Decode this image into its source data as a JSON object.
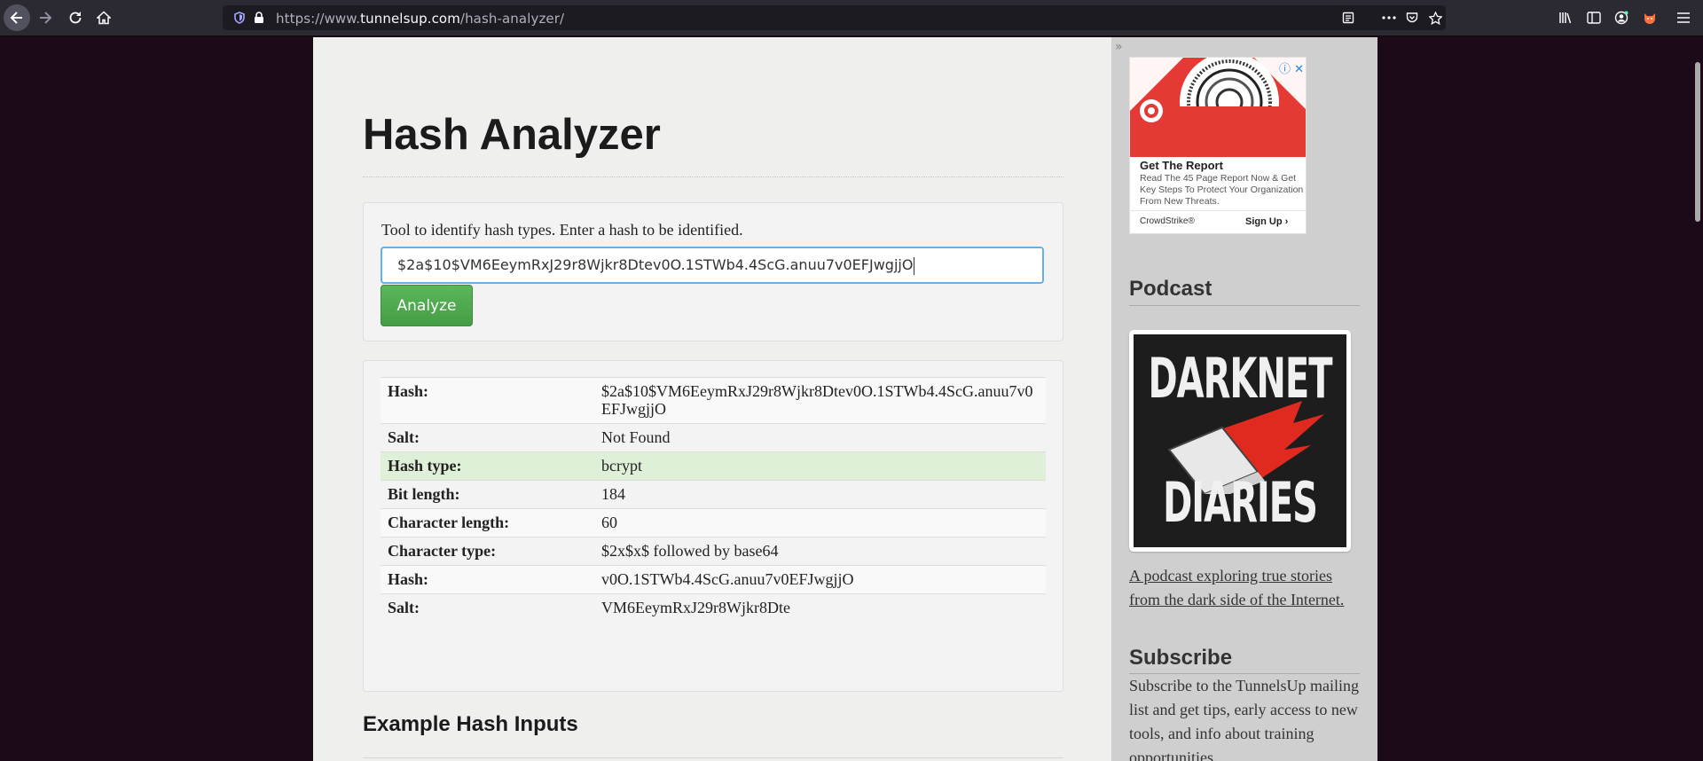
{
  "browser": {
    "url_scheme": "https://www.",
    "url_host": "tunnelsup.com",
    "url_path": "/hash-analyzer/"
  },
  "page": {
    "title": "Hash Analyzer",
    "intro": "Tool to identify hash types. Enter a hash to be identified.",
    "hash_input_value": "$2a$10$VM6EeymRxJ29r8Wjkr8Dtev0O.1STWb4.4ScG.anuu7v0EFJwgjjO",
    "analyze_label": "Analyze",
    "results": [
      {
        "key": "Hash:",
        "value": "$2a$10$VM6EeymRxJ29r8Wjkr8Dtev0O.1STWb4.4ScG.anuu7v0EFJwgjjO"
      },
      {
        "key": "Salt:",
        "value": "Not Found"
      },
      {
        "key": "Hash type:",
        "value": "bcrypt"
      },
      {
        "key": "Bit length:",
        "value": "184"
      },
      {
        "key": "Character length:",
        "value": "60"
      },
      {
        "key": "Character type:",
        "value": "$2x$x$ followed by base64"
      },
      {
        "key": "Hash:",
        "value": "v0O.1STWb4.4ScG.anuu7v0EFJwgjjO"
      },
      {
        "key": "Salt:",
        "value": "VM6EeymRxJ29r8Wjkr8Dte"
      }
    ],
    "examples_heading": "Example Hash Inputs"
  },
  "sidebar": {
    "ad": {
      "title": "Get The Report",
      "body": "Read The 45 Page Report Now & Get Key Steps To Protect Your Organization From New Threats.",
      "brand": "CrowdStrike®",
      "cta": "Sign Up"
    },
    "podcast_heading": "Podcast",
    "podcast_art_line1": "DARKNET",
    "podcast_art_line2": "DIARIES",
    "podcast_link": "A podcast exploring true stories from the dark side of the Internet.",
    "subscribe_heading": "Subscribe",
    "subscribe_text": "Subscribe to the TunnelsUp mailing list and get tips, early access to new tools, and info about training opportunities."
  },
  "colors": {
    "page_bg": "#1c0a18",
    "button_green": "#5bb75b",
    "highlight_row": "#dff0d8",
    "input_focus": "#66afe9"
  }
}
